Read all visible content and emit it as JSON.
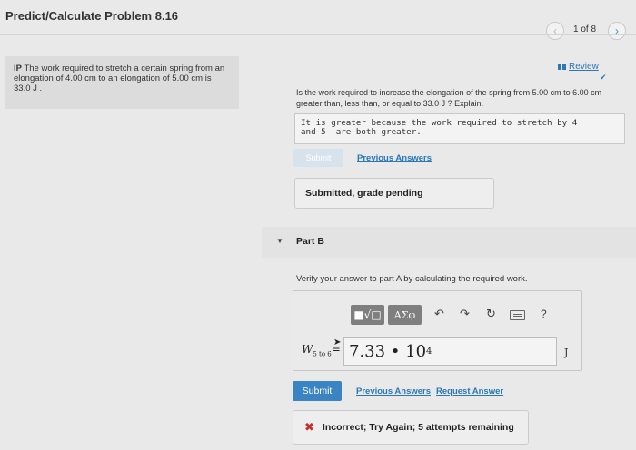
{
  "header": {
    "title": "Predict/Calculate Problem 8.16",
    "page_count": "1 of 8",
    "prev_glyph": "‹",
    "next_glyph": "›"
  },
  "problem": {
    "tag": "IP",
    "text": " The work required to stretch a certain spring from an elongation of 4.00 cm to an elongation of 5.00 cm is 33.0 J ."
  },
  "review": {
    "label": "Review"
  },
  "part_a": {
    "question": "Is the work required to increase the elongation of the spring from 5.00 cm to 6.00 cm greater than, less than, or equal to 33.0 J ? Explain.",
    "answer_text": "It is greater because the work required to stretch by 4\nand 5  are both greater.",
    "submit_label": "Submit",
    "previous_answers_label": "Previous Answers",
    "status": "Submitted, grade pending"
  },
  "part_b": {
    "label": "Part B",
    "question": "Verify your answer to part A by calculating the required work.",
    "toolbar": {
      "templates_label": "■√□",
      "symbols_label": "ΑΣφ",
      "undo_glyph": "↶",
      "redo_glyph": "↷",
      "reset_glyph": "↻",
      "help_glyph": "?"
    },
    "variable": "W",
    "variable_sub": "5 to 6",
    "equals": "=",
    "answer_mantissa": "7.33 • 10",
    "answer_exponent": "4",
    "unit": "J",
    "submit_label": "Submit",
    "previous_answers_label": "Previous Answers",
    "request_answer_label": "Request Answer",
    "status": "Incorrect; Try Again; 5 attempts remaining"
  },
  "colors": {
    "link": "#2b77b9",
    "submit_active": "#3b84c4",
    "incorrect": "#cc2a2a"
  }
}
